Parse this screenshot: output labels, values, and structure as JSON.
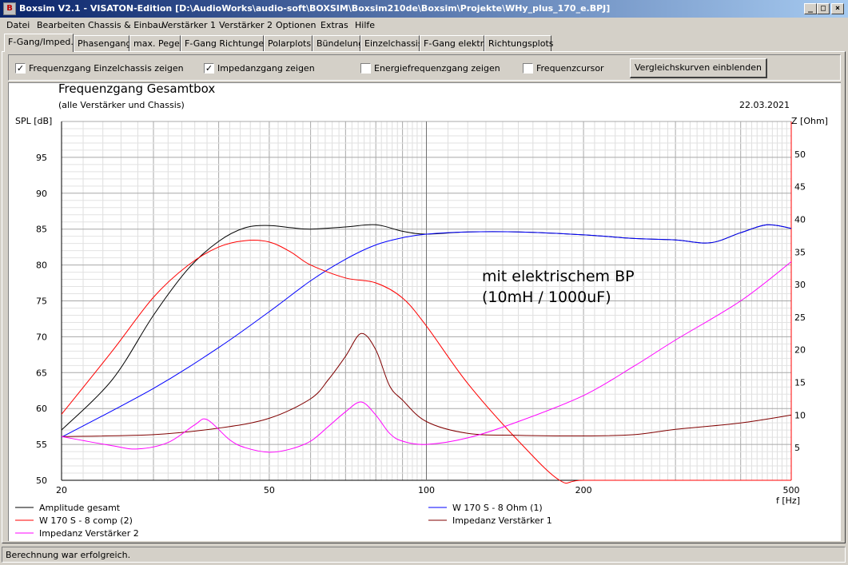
{
  "window": {
    "title": "Boxsim V2.1 - VISATON-Edition [D:\\AudioWorks\\audio-soft\\BOXSIM\\Boxsim210de\\Boxsim\\Projekte\\WHy_plus_170_e.BPJ]",
    "app_icon": "boxsim-icon",
    "buttons": {
      "minimize": "_",
      "maximize": "□",
      "close": "×"
    }
  },
  "menu": [
    "Datei",
    "Bearbeiten",
    "Chassis & Einbau",
    "Verstärker 1",
    "Verstärker 2",
    "Optionen",
    "Extras",
    "Hilfe"
  ],
  "tabs": [
    {
      "label": "F-Gang/Imped.",
      "active": true
    },
    {
      "label": "Phasengang"
    },
    {
      "label": "max. Pegel"
    },
    {
      "label": "F-Gang Richtungen"
    },
    {
      "label": "Polarplots"
    },
    {
      "label": "Bündelung"
    },
    {
      "label": "Einzelchassis"
    },
    {
      "label": "F-Gang elektr."
    },
    {
      "label": "Richtungsplots"
    }
  ],
  "options": [
    {
      "label": "Frequenzgang Einzelchassis zeigen",
      "checked": true
    },
    {
      "label": "Impedanzgang zeigen",
      "checked": true
    },
    {
      "label": "Energiefrequenzgang zeigen",
      "checked": false
    },
    {
      "label": "Frequenzcursor",
      "checked": false
    }
  ],
  "compare_button": "Vergleichskurven einblenden",
  "status": "Berechnung war erfolgreich.",
  "chart_data": {
    "type": "line",
    "title": "Frequenzgang Gesamtbox",
    "subtitle": "(alle Verstärker und Chassis)",
    "date": "22.03.2021",
    "annotation": [
      "mit elektrischem BP",
      "(10mH / 1000uF)"
    ],
    "xlabel": "f [Hz]",
    "ylabel_left": "SPL [dB]",
    "ylabel_right": "Z [Ohm]",
    "x_scale": "log",
    "xlim": [
      20,
      500
    ],
    "x_ticks": [
      20,
      50,
      100,
      200,
      500
    ],
    "ylim_left": [
      50,
      100
    ],
    "y_ticks_left": [
      50,
      55,
      60,
      65,
      70,
      75,
      80,
      85,
      90,
      95
    ],
    "ylim_right": [
      0,
      55
    ],
    "y_ticks_right": [
      5,
      10,
      15,
      20,
      25,
      30,
      35,
      40,
      45,
      50
    ],
    "grid": true,
    "series": [
      {
        "name": "Amplitude gesamt",
        "color": "#000000",
        "axis": "left",
        "x": [
          20,
          25,
          30,
          35,
          40,
          45,
          50,
          55,
          60,
          70,
          80,
          90,
          100,
          120,
          150,
          200,
          250,
          300,
          350,
          400,
          450,
          500
        ],
        "y": [
          57,
          64,
          73,
          79.5,
          83.3,
          85.2,
          85.5,
          85.2,
          85,
          85.3,
          85.6,
          84.7,
          84.3,
          84.6,
          84.6,
          84.2,
          83.7,
          83.5,
          83.1,
          84.5,
          85.6,
          85.1
        ]
      },
      {
        "name": "W 170 S - 8 Ohm (1)",
        "color": "#0000ff",
        "axis": "left",
        "x": [
          20,
          30,
          40,
          50,
          60,
          70,
          80,
          90,
          100,
          120,
          150,
          200,
          250,
          300,
          350,
          400,
          450,
          500
        ],
        "y": [
          56,
          62.8,
          68.5,
          73.5,
          77.8,
          80.8,
          82.8,
          83.8,
          84.3,
          84.6,
          84.6,
          84.2,
          83.7,
          83.5,
          83.1,
          84.5,
          85.6,
          85.1
        ]
      },
      {
        "name": "W 170 S - 8 comp (2)",
        "color": "#ff0000",
        "axis": "left",
        "x": [
          20,
          25,
          30,
          35,
          40,
          45,
          50,
          55,
          60,
          70,
          80,
          90,
          100,
          120,
          150,
          180,
          200,
          300,
          500
        ],
        "y": [
          59.2,
          68,
          75.5,
          80,
          82.5,
          83.4,
          83.2,
          81.8,
          80,
          78.2,
          77.5,
          75.4,
          71.5,
          63.5,
          55.5,
          50,
          50,
          50,
          50
        ]
      },
      {
        "name": "Impedanz Verstärker 1",
        "color": "#800000",
        "axis": "right",
        "x": [
          20,
          30,
          40,
          50,
          60,
          65,
          70,
          75,
          80,
          85,
          90,
          100,
          120,
          150,
          200,
          250,
          300,
          400,
          500
        ],
        "y": [
          6.7,
          7.0,
          8.0,
          9.5,
          12.5,
          15.5,
          19,
          22.5,
          20,
          14.5,
          12.3,
          9,
          7.2,
          6.9,
          6.8,
          7.0,
          7.8,
          8.8,
          10
        ]
      },
      {
        "name": "Impedanz Verstärker 2",
        "color": "#ff00ff",
        "axis": "right",
        "x": [
          20,
          25,
          28,
          32,
          36,
          38,
          42,
          45,
          50,
          55,
          60,
          65,
          70,
          75,
          80,
          85,
          90,
          100,
          120,
          150,
          200,
          250,
          300,
          400,
          500
        ],
        "y": [
          6.7,
          5.3,
          4.8,
          5.8,
          8.5,
          9.3,
          6.2,
          5.0,
          4.3,
          4.8,
          6.0,
          8.3,
          10.5,
          12.0,
          10.0,
          7.2,
          6.0,
          5.5,
          6.5,
          9.0,
          13.0,
          17.5,
          21.5,
          27.5,
          33.5
        ]
      }
    ]
  }
}
